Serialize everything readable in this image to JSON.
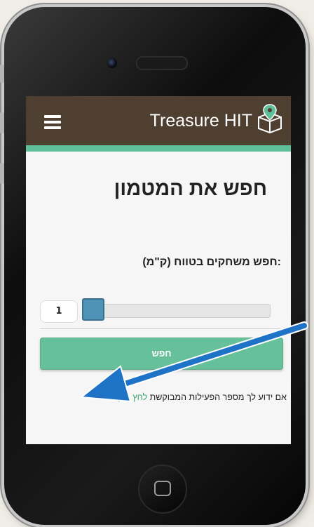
{
  "app": {
    "title": "Treasure HIT",
    "header_color": "#4e3f30",
    "accent_color": "#5fbf9a"
  },
  "icons": {
    "menu": "hamburger-menu-icon",
    "logo": "treasure-chest-map-pin-icon",
    "home_button": "home-square-icon"
  },
  "main": {
    "title": "חפש את המטמון",
    "range_label": "חפש משחקים בטווח (ק\"מ):",
    "range_value": "1",
    "slider_position": 0,
    "search_button": "חפש",
    "help_text": "אם ידוע לך מספר הפעילות המבוקשת",
    "help_link": "לחץ כאן"
  },
  "annotation": {
    "arrow_color": "#1f73c6",
    "arrow_target": "help-link"
  }
}
